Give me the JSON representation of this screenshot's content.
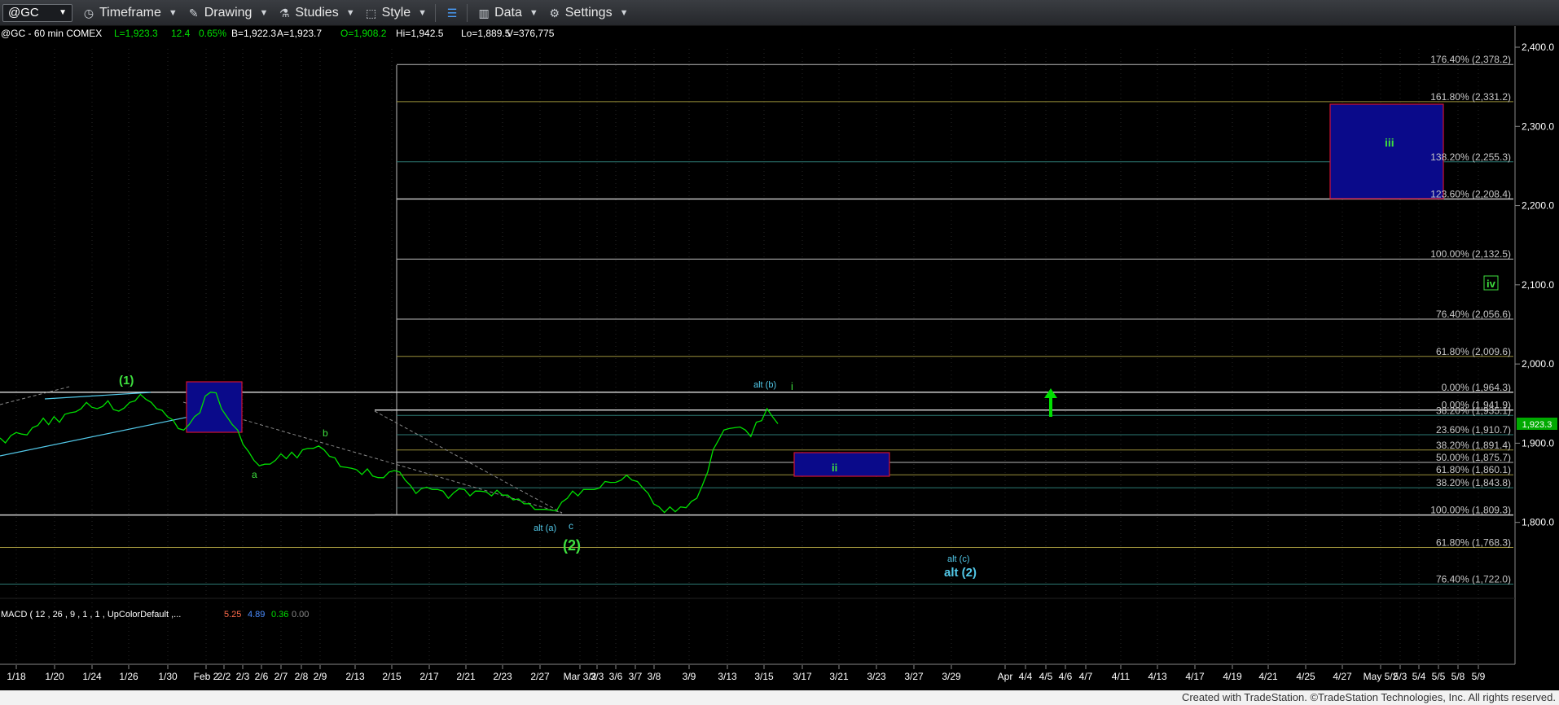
{
  "toolbar": {
    "symbol": "@GC",
    "timeframe_label": "Timeframe",
    "drawing_label": "Drawing",
    "studies_label": "Studies",
    "style_label": "Style",
    "data_label": "Data",
    "settings_label": "Settings"
  },
  "header": {
    "instrument": "@GC - 60 min  COMEX",
    "last": "L=1,923.3",
    "change": "12.4",
    "change_pct": "0.65%",
    "bid": "B=1,922.3",
    "ask": "A=1,923.7",
    "open": "O=1,908.2",
    "hi": "Hi=1,942.5",
    "lo": "Lo=1,889.5",
    "volume": "V=376,775"
  },
  "macd": {
    "label": "MACD ( 12 , 26 , 9 , 1 , 1 , UpColorDefault ,...",
    "v1": "5.25",
    "v2": "4.89",
    "v3": "0.36",
    "v4": "0.00"
  },
  "footer": "Created with TradeStation. ©TradeStation Technologies, Inc. All rights reserved.",
  "colors": {
    "price": "#00e000",
    "wave_green": "#3ee03e",
    "wave_cyan": "#52c8e8",
    "box_fill": "#0a0a8a",
    "box_border": "#d01030",
    "last_price_bg": "#00aa00"
  },
  "chart_data": {
    "type": "line",
    "title": "",
    "ylim": [
      1740,
      2410
    ],
    "y_ticks": [
      "2,400.0",
      "2,300.0",
      "2,200.0",
      "2,100.0",
      "2,000.0",
      "1,900.0",
      "1,800.0"
    ],
    "y_tick_values": [
      2400,
      2300,
      2200,
      2100,
      2000,
      1900,
      1800
    ],
    "x_ticks": [
      "1/18",
      "1/20",
      "1/24",
      "1/26",
      "1/30",
      "Feb 2",
      "2/2",
      "2/3",
      "2/6",
      "2/7",
      "2/8",
      "2/9",
      "2/13",
      "2/15",
      "2/17",
      "2/21",
      "2/23",
      "2/27",
      "Mar 3/2",
      "3/3",
      "3/6",
      "3/7",
      "3/8",
      "3/9",
      "3/13",
      "3/15",
      "3/17",
      "3/21",
      "3/23",
      "3/27",
      "3/29",
      "Apr",
      "4/4",
      "4/5",
      "4/6",
      "4/7",
      "4/11",
      "4/13",
      "4/17",
      "4/19",
      "4/21",
      "4/25",
      "4/27",
      "May 5/2",
      "5/3",
      "5/4",
      "5/5",
      "5/8",
      "5/9"
    ],
    "last_price": "1,923.3",
    "series": [
      {
        "values": [
          1905,
          1902,
          1908,
          1915,
          1910,
          1912,
          1918,
          1924,
          1930,
          1925,
          1932,
          1928,
          1935,
          1940,
          1938,
          1945,
          1950,
          1947,
          1942,
          1948,
          1952,
          1944,
          1939,
          1946,
          1950,
          1955,
          1960,
          1957,
          1950,
          1945,
          1940,
          1935,
          1928,
          1920,
          1915,
          1925,
          1932,
          1940,
          1958,
          1966,
          1962,
          1945,
          1932,
          1925,
          1915,
          1900,
          1888,
          1880,
          1870,
          1875,
          1872,
          1880,
          1885,
          1882,
          1887,
          1883,
          1890,
          1895,
          1892,
          1898,
          1890,
          1885,
          1880,
          1872,
          1868,
          1870,
          1865,
          1862,
          1866,
          1860,
          1855,
          1858,
          1862,
          1867,
          1862,
          1855,
          1845,
          1838,
          1841,
          1846,
          1840,
          1843,
          1838,
          1832,
          1836,
          1844,
          1840,
          1835,
          1838,
          1841,
          1837,
          1835,
          1839,
          1836,
          1833,
          1830,
          1828,
          1825,
          1822,
          1818,
          1815,
          1818,
          1814,
          1816,
          1824,
          1832,
          1838,
          1835,
          1840,
          1843,
          1840,
          1845,
          1850,
          1852,
          1849,
          1855,
          1858,
          1855,
          1850,
          1845,
          1835,
          1825,
          1818,
          1814,
          1818,
          1815,
          1818,
          1820,
          1825,
          1832,
          1845,
          1865,
          1890,
          1905,
          1915,
          1920,
          1918,
          1922,
          1915,
          1910,
          1925,
          1930,
          1942,
          1935,
          1923
        ]
      }
    ],
    "fib_levels": [
      {
        "label": "176.40% (2,378.2)",
        "value": 2378.2
      },
      {
        "label": "161.80% (2,331.2)",
        "value": 2331.2
      },
      {
        "label": "138.20% (2,255.3)",
        "value": 2255.3
      },
      {
        "label": "123.60% (2,208.4)",
        "value": 2208.4
      },
      {
        "label": "100.00% (2,132.5)",
        "value": 2132.5
      },
      {
        "label": "76.40% (2,056.6)",
        "value": 2056.6
      },
      {
        "label": "61.80% (2,009.6)",
        "value": 2009.6
      },
      {
        "label": "0.00% (1,964.3)",
        "value": 1964.3
      },
      {
        "label": "0.00% (1,941.9)",
        "value": 1941.9
      },
      {
        "label": "38.20% (1,935.1)",
        "value": 1935.1
      },
      {
        "label": "23.60% (1,910.7)",
        "value": 1910.7
      },
      {
        "label": "38.20% (1,891.4)",
        "value": 1891.4
      },
      {
        "label": "50.00% (1,875.7)",
        "value": 1875.7
      },
      {
        "label": "61.80% (1,860.1)",
        "value": 1860.1
      },
      {
        "label": "38.20% (1,843.8)",
        "value": 1843.8
      },
      {
        "label": "100.00% (1,809.3)",
        "value": 1809.3
      },
      {
        "label": "61.80% (1,768.3)",
        "value": 1768.3
      },
      {
        "label": "76.40% (1,722.0)",
        "value": 1722.0
      }
    ],
    "wave_labels": [
      {
        "text": "(1)",
        "color": "green"
      },
      {
        "text": "a",
        "color": "green"
      },
      {
        "text": "b",
        "color": "green"
      },
      {
        "text": "c",
        "color": "cyan"
      },
      {
        "text": "alt (a)",
        "color": "cyan"
      },
      {
        "text": "(2)",
        "color": "green"
      },
      {
        "text": "alt (b)",
        "color": "cyan"
      },
      {
        "text": "i",
        "color": "green"
      },
      {
        "text": "ii",
        "color": "green"
      },
      {
        "text": "iii",
        "color": "green"
      },
      {
        "text": "iv",
        "color": "green"
      },
      {
        "text": "alt (c)",
        "color": "cyan"
      },
      {
        "text": "alt (2)",
        "color": "cyan"
      }
    ]
  }
}
